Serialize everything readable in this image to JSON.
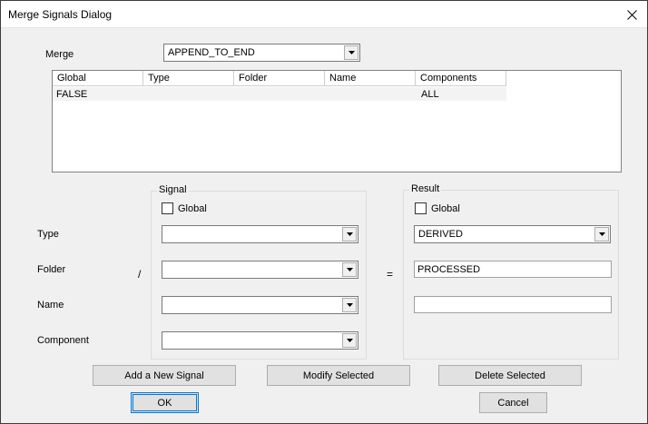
{
  "window": {
    "title": "Merge Signals Dialog"
  },
  "merge": {
    "label": "Merge",
    "value": "APPEND_TO_END"
  },
  "list": {
    "columns": [
      "Global",
      "Type",
      "Folder",
      "Name",
      "Components"
    ],
    "rows": [
      {
        "global": "FALSE",
        "type": "",
        "folder": "",
        "name": "",
        "components": "ALL"
      }
    ]
  },
  "fields": {
    "type_label": "Type",
    "folder_label": "Folder",
    "name_label": "Name",
    "component_label": "Component",
    "slash": "/",
    "equals": "="
  },
  "signal": {
    "legend": "Signal",
    "global_label": "Global",
    "global_checked": false,
    "type": "",
    "folder": "",
    "name": "",
    "component": ""
  },
  "result": {
    "legend": "Result",
    "global_label": "Global",
    "global_checked": false,
    "type": "DERIVED",
    "folder": "PROCESSED",
    "name": ""
  },
  "buttons": {
    "add": "Add a New Signal",
    "modify": "Modify Selected",
    "delete": "Delete Selected",
    "ok": "OK",
    "cancel": "Cancel"
  }
}
